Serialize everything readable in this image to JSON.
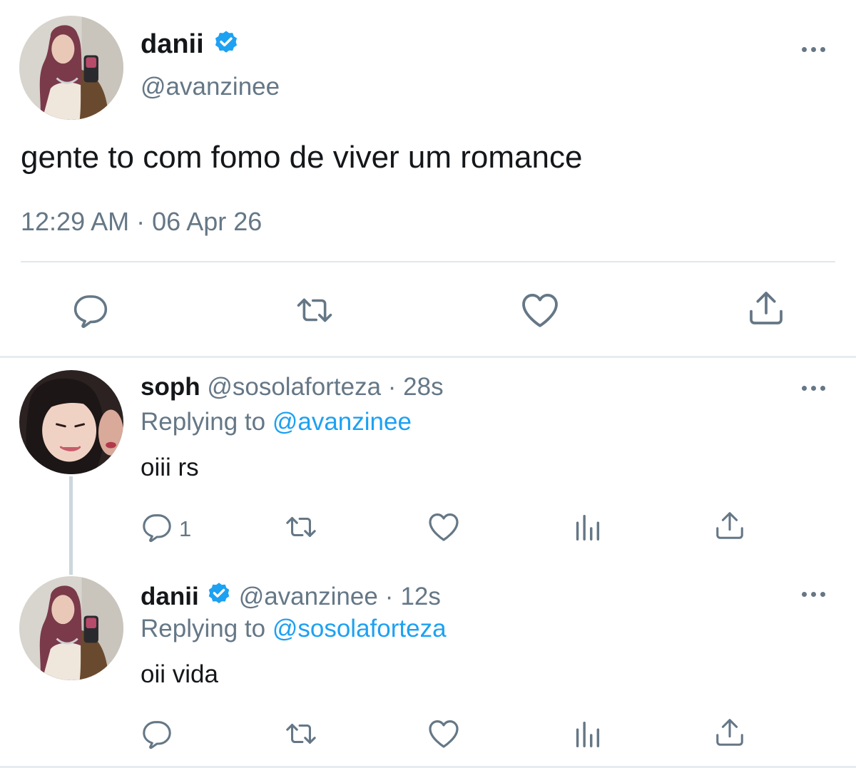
{
  "main_tweet": {
    "author_name": "danii",
    "handle": "@avanzinee",
    "text": "gente to com fomo de viver um romance",
    "time": "12:29 AM",
    "separator": "·",
    "date": "06 Apr 26"
  },
  "replies": [
    {
      "author_name": "soph",
      "handle": "@sosolaforteza",
      "separator": "·",
      "age": "28s",
      "replying_prefix": "Replying to",
      "replying_to": "@avanzinee",
      "text": "oiii rs",
      "reply_count": "1"
    },
    {
      "author_name": "danii",
      "handle": "@avanzinee",
      "separator": "·",
      "age": "12s",
      "replying_prefix": "Replying to",
      "replying_to": "@sosolaforteza",
      "text": "oii vida",
      "reply_count": ""
    }
  ],
  "icons": [
    "reply-icon",
    "retweet-icon",
    "like-icon",
    "analytics-icon",
    "share-icon",
    "more-icon",
    "verified-icon"
  ],
  "colors": {
    "accent": "#1da1f2",
    "muted": "#657786",
    "text": "#14171a",
    "divider": "#e1e8ed"
  }
}
